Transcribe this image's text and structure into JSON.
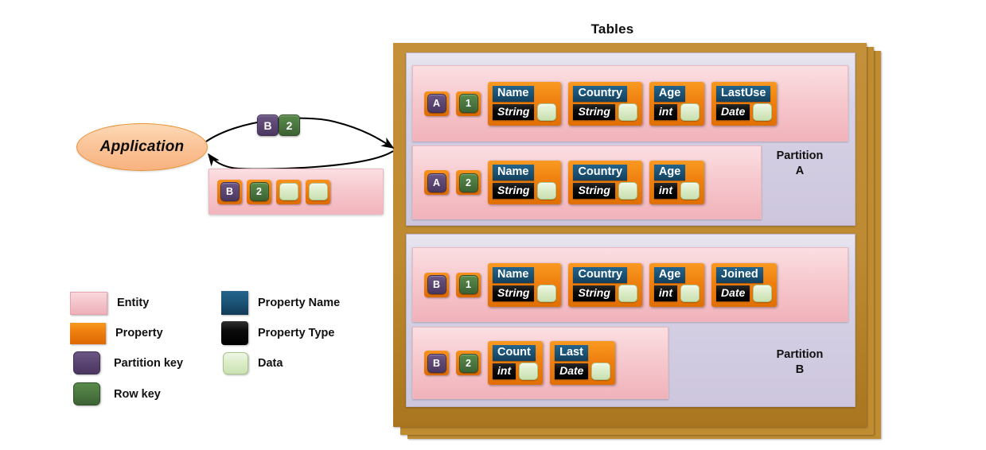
{
  "title": "Tables",
  "application": {
    "label": "Application"
  },
  "request": {
    "partition_key": "B",
    "row_key": "2"
  },
  "returned_entity": {
    "partition_key": "B",
    "row_key": "2",
    "data_cells": 2
  },
  "partitions": [
    {
      "id": "a",
      "label_line1": "Partition",
      "label_line2": "A",
      "entities": [
        {
          "partition_key": "A",
          "row_key": "1",
          "properties": [
            {
              "name": "Name",
              "type": "String"
            },
            {
              "name": "Country",
              "type": "String"
            },
            {
              "name": "Age",
              "type": "int"
            },
            {
              "name": "LastUse",
              "type": "Date"
            }
          ]
        },
        {
          "partition_key": "A",
          "row_key": "2",
          "properties": [
            {
              "name": "Name",
              "type": "String"
            },
            {
              "name": "Country",
              "type": "String"
            },
            {
              "name": "Age",
              "type": "int"
            }
          ]
        }
      ]
    },
    {
      "id": "b",
      "label_line1": "Partition",
      "label_line2": "B",
      "entities": [
        {
          "partition_key": "B",
          "row_key": "1",
          "properties": [
            {
              "name": "Name",
              "type": "String"
            },
            {
              "name": "Country",
              "type": "String"
            },
            {
              "name": "Age",
              "type": "int"
            },
            {
              "name": "Joined",
              "type": "Date"
            }
          ]
        },
        {
          "partition_key": "B",
          "row_key": "2",
          "properties": [
            {
              "name": "Count",
              "type": "int"
            },
            {
              "name": "Last",
              "type": "Date"
            }
          ]
        }
      ]
    }
  ],
  "legend": {
    "left_column": [
      {
        "label": "Entity",
        "swatch": "entity-swatch",
        "color": "#f4c3ca"
      },
      {
        "label": "Property",
        "swatch": "property-swatch",
        "color": "#ed7d0d"
      },
      {
        "label": "Partition key",
        "swatch": "partition-key-swatch",
        "color": "#584370"
      },
      {
        "label": "Row key",
        "swatch": "row-key-swatch",
        "color": "#4a7540"
      }
    ],
    "right_column": [
      {
        "label": "Property Name",
        "swatch": "property-name-swatch",
        "color": "#1b5376"
      },
      {
        "label": "Property Type",
        "swatch": "property-type-swatch",
        "color": "#000000"
      },
      {
        "label": "Data",
        "swatch": "data-swatch",
        "color": "#ddedca"
      }
    ]
  },
  "colors": {
    "table_frame": "#c08c32",
    "partition_bg": "#d7d2e6",
    "entity_bg": "#f4c3ca",
    "property": "#ed7d0d",
    "property_name": "#1b5376",
    "property_type": "#000000",
    "data": "#ddedca",
    "partition_key": "#584370",
    "row_key": "#4a7540",
    "application": "#fbc59a"
  }
}
